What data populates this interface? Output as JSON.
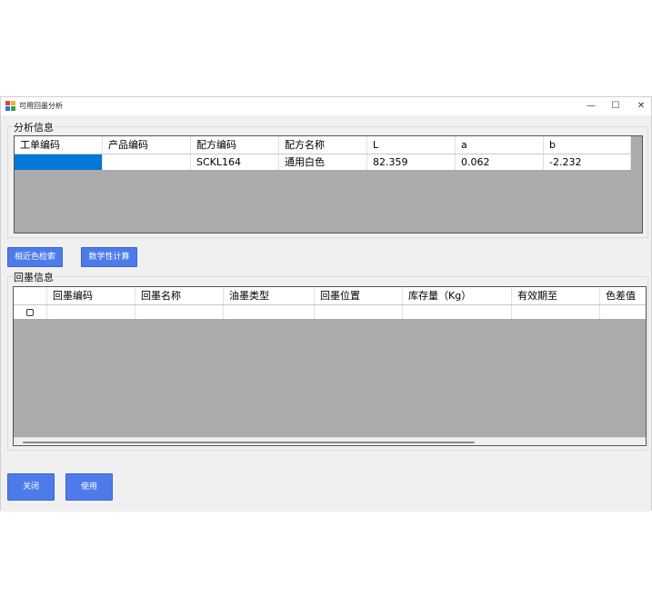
{
  "window": {
    "title": "可用回墨分析",
    "controls": {
      "minimize": "—",
      "maximize": "☐",
      "close": "✕"
    }
  },
  "analysis": {
    "label": "分析信息",
    "headers": [
      "工单编码",
      "产品编码",
      "配方编码",
      "配方名称",
      "L",
      "a",
      "b"
    ],
    "row": [
      "",
      "",
      "SCKL164",
      "通用白色",
      "82.359",
      "0.062",
      "-2.232"
    ]
  },
  "buttons": {
    "similar_search": "相近色检索",
    "math_calc": "数学性计算",
    "close": "关闭",
    "use": "使用"
  },
  "ink": {
    "label": "回墨信息",
    "headers": [
      "",
      "回墨编码",
      "回墨名称",
      "油墨类型",
      "回墨位置",
      "库存量（Kg）",
      "有效期至",
      "色差值"
    ],
    "rows": [
      [
        "",
        "",
        "",
        "",
        "",
        "",
        "",
        ""
      ]
    ]
  },
  "colors": {
    "accent": "#4d7bea",
    "selection": "#0078d7",
    "grid_bg": "#ababab"
  }
}
